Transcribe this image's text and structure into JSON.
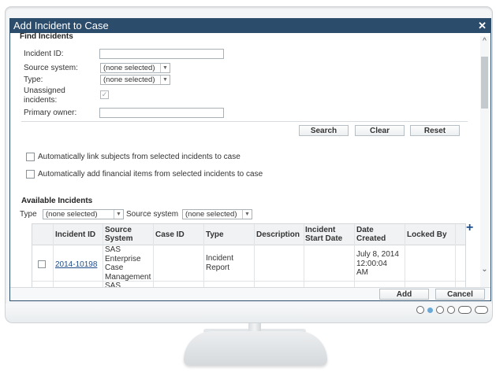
{
  "dialog": {
    "title": "Add Incident to Case",
    "close_icon": "close-icon",
    "find_section": {
      "heading": "Find Incidents",
      "incident_id_label": "Incident ID:",
      "incident_id_value": "",
      "source_system_label": "Source system:",
      "source_system_value": "(none selected)",
      "type_label": "Type:",
      "type_value": "(none selected)",
      "unassigned_label_line1": "Unassigned",
      "unassigned_label_line2": "incidents:",
      "unassigned_checked": true,
      "primary_owner_label": "Primary owner:",
      "primary_owner_value": ""
    },
    "buttons": {
      "search": "Search",
      "clear": "Clear",
      "reset": "Reset",
      "add": "Add",
      "cancel": "Cancel"
    },
    "options": {
      "link_subjects": "Automatically link subjects from selected incidents to case",
      "add_financial": "Automatically add financial items from selected incidents to case"
    },
    "available": {
      "heading": "Available Incidents",
      "filter_type_label": "Type",
      "filter_type_value": "(none selected)",
      "filter_source_label": "Source system",
      "filter_source_value": "(none selected)",
      "columns": {
        "incident_id": "Incident ID",
        "source_system_line1": "Source",
        "source_system_line2": "System",
        "case_id": "Case ID",
        "type": "Type",
        "description": "Description",
        "start_date_line1": "Incident",
        "start_date_line2": "Start Date",
        "date_created_line1": "Date",
        "date_created_line2": "Created",
        "locked_by": "Locked By"
      },
      "rows": [
        {
          "incident_id": "2014-10198",
          "source_line1": "SAS",
          "source_line2": "Enterprise",
          "source_line3": "Case",
          "source_line4": "Management",
          "case_id": "",
          "type_line1": "Incident",
          "type_line2": "Report",
          "description": "",
          "start_date": "",
          "created_line1": "July 8, 2014",
          "created_line2": "12:00:04",
          "created_line3": "AM",
          "locked_by": ""
        }
      ],
      "partial_next_row": "SAS"
    }
  }
}
